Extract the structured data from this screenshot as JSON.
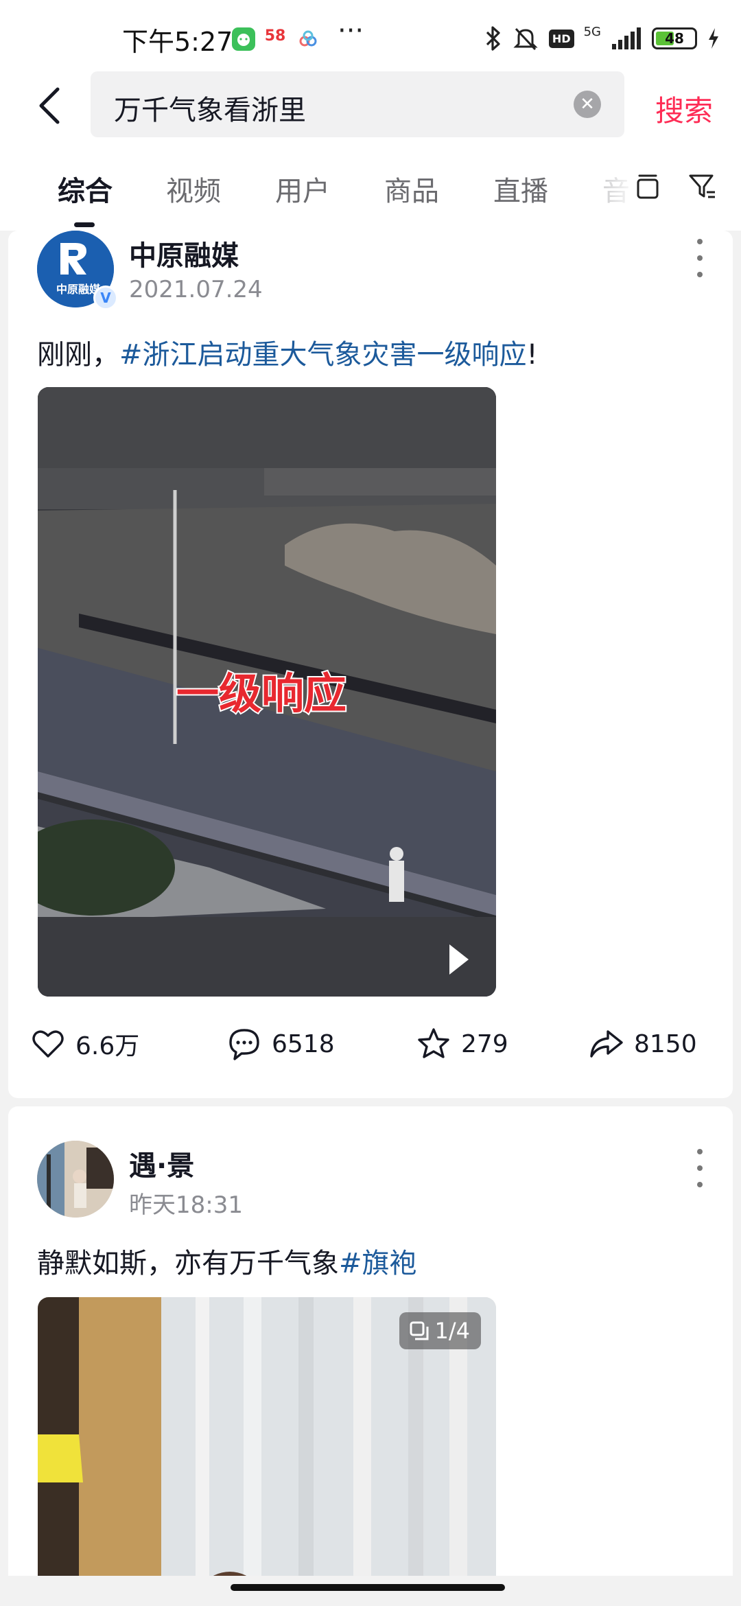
{
  "status_bar": {
    "time": "下午5:27",
    "app_badge": "58",
    "more": "···",
    "network_label": "5G",
    "hd_label": "HD",
    "battery_level": "48"
  },
  "header": {
    "search_query": "万千气象看浙里",
    "search_button_label": "搜索"
  },
  "tabs": [
    {
      "label": "综合",
      "active": true
    },
    {
      "label": "视频"
    },
    {
      "label": "用户"
    },
    {
      "label": "商品"
    },
    {
      "label": "直播"
    },
    {
      "label": "音"
    }
  ],
  "posts": [
    {
      "author": "中原融媒",
      "avatar_text": "中原融媒",
      "date": "2021.07.24",
      "text_prefix": "刚刚，",
      "hashtag": "#浙江启动重大气象灾害一级响应",
      "text_suffix": "!",
      "video_caption": "一级响应",
      "likes": "6.6万",
      "comments": "6518",
      "favorites": "279",
      "shares": "8150"
    },
    {
      "author": "遇·景",
      "date": "昨天18:31",
      "text_prefix": "静默如斯，亦有万千气象",
      "hashtag": "#旗袍",
      "image_counter": "1/4"
    }
  ],
  "colors": {
    "accent": "#fe2c55",
    "hashtag": "#1c5a9b",
    "verified": "#3b86f7"
  }
}
